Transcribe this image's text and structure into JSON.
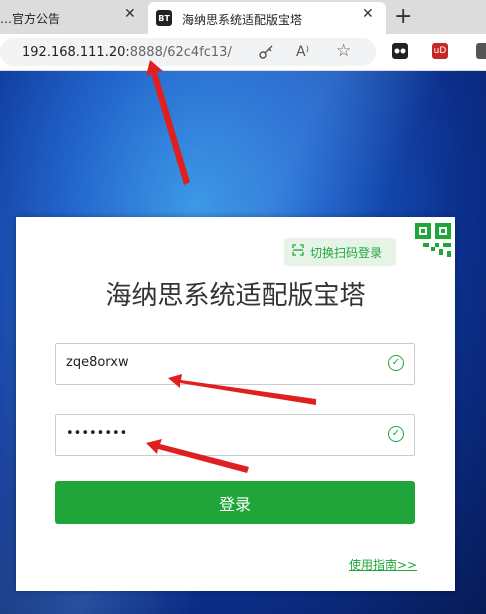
{
  "browser": {
    "tabs": [
      {
        "label": "…官方公告",
        "close": "✕"
      },
      {
        "favicon": "BT",
        "label": "海纳思系统适配版宝塔",
        "close": "✕"
      }
    ],
    "new_tab": "+",
    "url_host": "192.168.111.20:",
    "url_rest": "8888/62c4fc13/",
    "extensions": [
      {
        "name": "extension-icon",
        "color": "#222"
      },
      {
        "name": "ublock-icon",
        "label": "uD",
        "color": "#c62828"
      }
    ]
  },
  "login": {
    "qr_switch_label": "切换扫码登录",
    "title": "海纳思系统适配版宝塔",
    "username_value": "zqe8orxw",
    "password_value": "••••••••",
    "submit_label": "登录",
    "guide_link": "使用指南>>",
    "accent_color": "#20a53a"
  }
}
